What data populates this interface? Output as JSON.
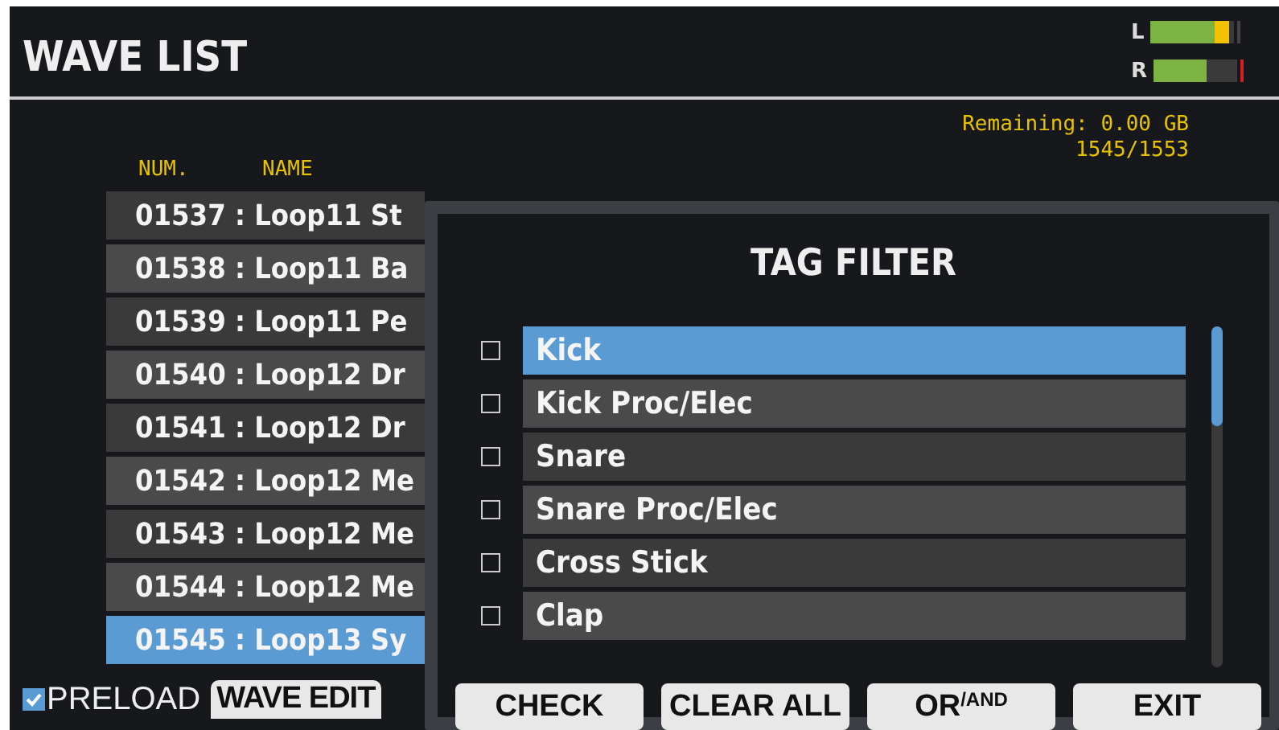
{
  "header": {
    "title": "WAVE LIST",
    "meters": [
      {
        "label": "L",
        "level": 0.93,
        "peak_hold": false
      },
      {
        "label": "R",
        "level": 0.64,
        "peak_hold": true
      }
    ]
  },
  "info": {
    "remaining": "Remaining: 0.00 GB",
    "count": "1545/1553"
  },
  "columns": [
    "NUM.",
    "NAME"
  ],
  "rows": [
    {
      "num": "01537",
      "sep": ":",
      "name": "Loop11 St",
      "selected": false
    },
    {
      "num": "01538",
      "sep": ":",
      "name": "Loop11 Ba",
      "selected": false
    },
    {
      "num": "01539",
      "sep": ":",
      "name": "Loop11 Pe",
      "selected": false
    },
    {
      "num": "01540",
      "sep": ":",
      "name": "Loop12 Dr",
      "selected": false
    },
    {
      "num": "01541",
      "sep": ":",
      "name": "Loop12 Dr",
      "selected": false
    },
    {
      "num": "01542",
      "sep": ":",
      "name": "Loop12 Me",
      "selected": false
    },
    {
      "num": "01543",
      "sep": ":",
      "name": "Loop12 Me",
      "selected": false
    },
    {
      "num": "01544",
      "sep": ":",
      "name": "Loop12 Me",
      "selected": false
    },
    {
      "num": "01545",
      "sep": ":",
      "name": "Loop13 Sy",
      "selected": true
    }
  ],
  "preload": {
    "label": "PRELOAD",
    "checked": true
  },
  "wave_edit_button": "WAVE EDIT",
  "dialog": {
    "title": "TAG FILTER",
    "tags": [
      {
        "label": "Kick",
        "checked": false,
        "selected": true
      },
      {
        "label": "Kick Proc/Elec",
        "checked": false,
        "selected": false
      },
      {
        "label": "Snare",
        "checked": false,
        "selected": false
      },
      {
        "label": "Snare Proc/Elec",
        "checked": false,
        "selected": false
      },
      {
        "label": "Cross Stick",
        "checked": false,
        "selected": false
      },
      {
        "label": "Clap",
        "checked": false,
        "selected": false
      }
    ],
    "buttons": [
      "CHECK",
      "CLEAR ALL",
      "OR$^{/AND}$",
      "EXIT"
    ]
  }
}
